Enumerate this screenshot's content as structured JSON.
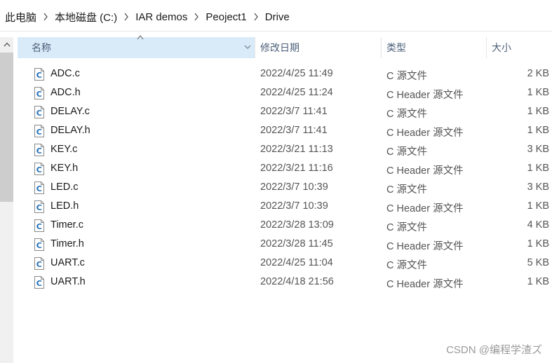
{
  "breadcrumb": [
    "此电脑",
    "本地磁盘 (C:)",
    "IAR demos",
    "Peoject1",
    "Drive"
  ],
  "columns": {
    "name": "名称",
    "date": "修改日期",
    "type": "类型",
    "size": "大小"
  },
  "files": [
    {
      "name": "ADC.c",
      "date": "2022/4/25 11:49",
      "type": "C 源文件",
      "size": "2 KB"
    },
    {
      "name": "ADC.h",
      "date": "2022/4/25 11:24",
      "type": "C Header 源文件",
      "size": "1 KB"
    },
    {
      "name": "DELAY.c",
      "date": "2022/3/7 11:41",
      "type": "C 源文件",
      "size": "1 KB"
    },
    {
      "name": "DELAY.h",
      "date": "2022/3/7 11:41",
      "type": "C Header 源文件",
      "size": "1 KB"
    },
    {
      "name": "KEY.c",
      "date": "2022/3/21 11:13",
      "type": "C 源文件",
      "size": "3 KB"
    },
    {
      "name": "KEY.h",
      "date": "2022/3/21 11:16",
      "type": "C Header 源文件",
      "size": "1 KB"
    },
    {
      "name": "LED.c",
      "date": "2022/3/7 10:39",
      "type": "C 源文件",
      "size": "3 KB"
    },
    {
      "name": "LED.h",
      "date": "2022/3/7 10:39",
      "type": "C Header 源文件",
      "size": "1 KB"
    },
    {
      "name": "Timer.c",
      "date": "2022/3/28 13:09",
      "type": "C 源文件",
      "size": "4 KB"
    },
    {
      "name": "Timer.h",
      "date": "2022/3/28 11:45",
      "type": "C Header 源文件",
      "size": "1 KB"
    },
    {
      "name": "UART.c",
      "date": "2022/4/25 11:04",
      "type": "C 源文件",
      "size": "5 KB"
    },
    {
      "name": "UART.h",
      "date": "2022/4/18 21:56",
      "type": "C Header 源文件",
      "size": "1 KB"
    }
  ],
  "file_icon": "c-source-file-icon",
  "watermark": "CSDN @编程学渣ズ",
  "colors": {
    "header_selected_bg": "#d9ebf9",
    "header_text": "#4c607a",
    "icon_letter": "#1f6fb5"
  }
}
